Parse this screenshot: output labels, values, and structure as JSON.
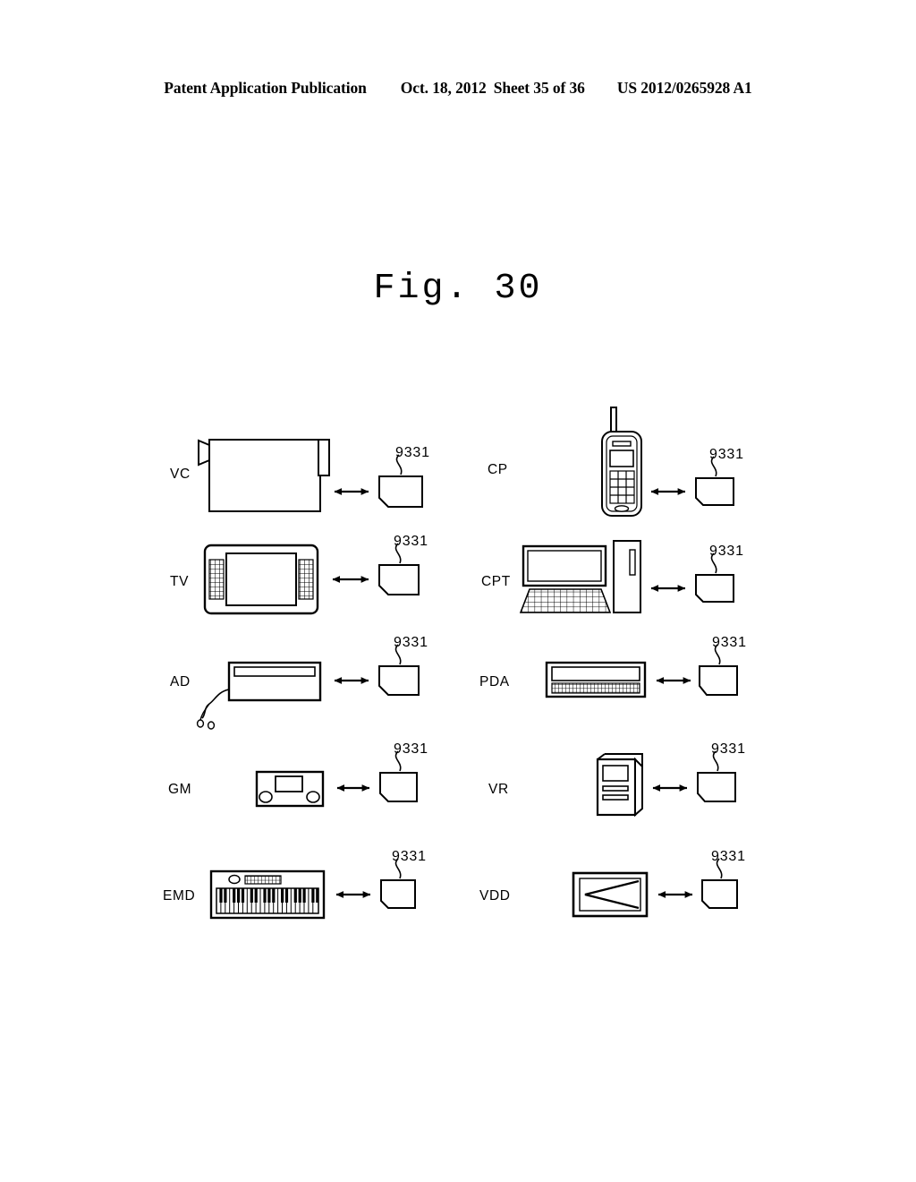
{
  "header": {
    "publication": "Patent Application Publication",
    "date": "Oct. 18, 2012",
    "sheet": "Sheet 35 of 36",
    "patent_number": "US 2012/0265928 A1"
  },
  "figure": {
    "title": "Fig.  30"
  },
  "diagram": {
    "reference_numeral": "9331",
    "left_column": [
      {
        "label": "VC",
        "device": "video-camera"
      },
      {
        "label": "TV",
        "device": "television"
      },
      {
        "label": "AD",
        "device": "audio-device"
      },
      {
        "label": "GM",
        "device": "game-machine"
      },
      {
        "label": "EMD",
        "device": "electronic-musical-device"
      }
    ],
    "right_column": [
      {
        "label": "CP",
        "device": "cellular-phone"
      },
      {
        "label": "CPT",
        "device": "computer"
      },
      {
        "label": "PDA",
        "device": "personal-digital-assistant"
      },
      {
        "label": "VR",
        "device": "voice-recorder"
      },
      {
        "label": "VDD",
        "device": "video-display-device"
      }
    ],
    "cards": [
      {
        "ref": "9331"
      },
      {
        "ref": "9331"
      },
      {
        "ref": "9331"
      },
      {
        "ref": "9331"
      },
      {
        "ref": "9331"
      },
      {
        "ref": "9331"
      },
      {
        "ref": "9331"
      },
      {
        "ref": "9331"
      },
      {
        "ref": "9331"
      },
      {
        "ref": "9331"
      }
    ],
    "colors": {
      "line": "#000000",
      "background": "#ffffff"
    }
  }
}
